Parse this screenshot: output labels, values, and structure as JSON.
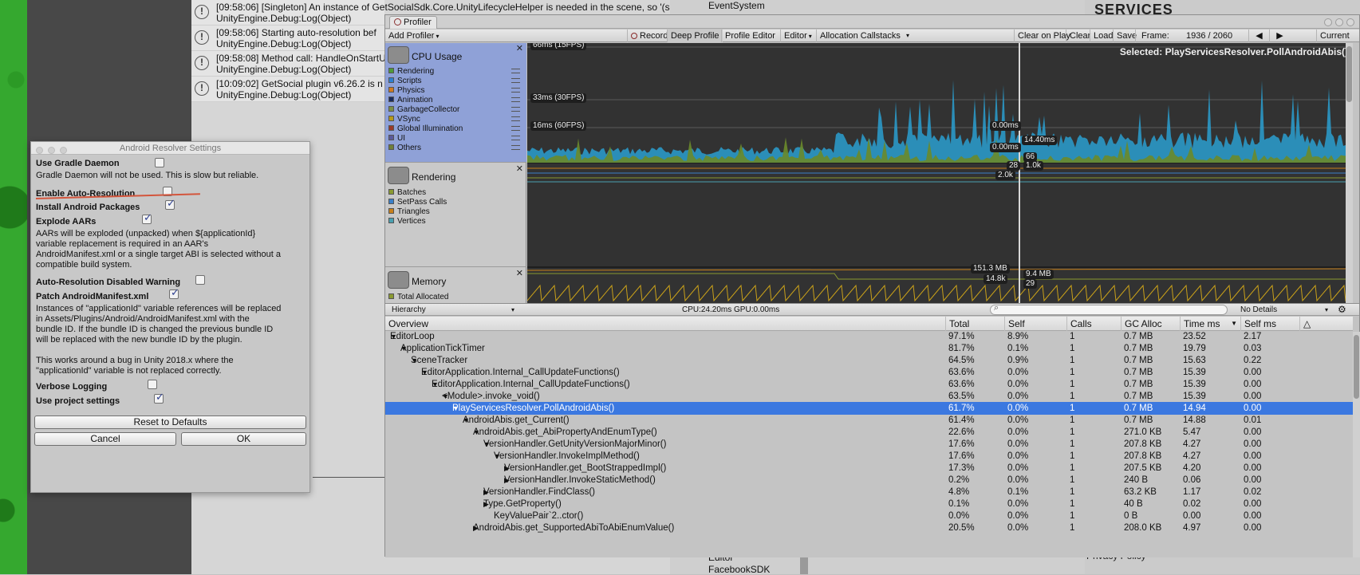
{
  "console": {
    "messages": [
      {
        "line1": "[09:58:06] [Singleton] An instance of GetSocialSdk.Core.UnityLifecycleHelper is needed in the scene, so '(s",
        "line2": "UnityEngine.Debug:Log(Object)"
      },
      {
        "line1": "[09:58:06] Starting auto-resolution bef",
        "line2": "UnityEngine.Debug:Log(Object)"
      },
      {
        "line1": "[09:58:08] Method call: HandleOnStartU",
        "line2": "UnityEngine.Debug:Log(Object)"
      },
      {
        "line1": "[10:09:02] GetSocial plugin v6.26.2 is n",
        "line2": "UnityEngine.Debug:Log(Object)"
      }
    ]
  },
  "hierarchy_bg": {
    "event_system": "EventSystem",
    "editor": "Editor",
    "facebook_sdk": "FacebookSDK"
  },
  "services": {
    "title": "SERVICES",
    "privacy": "Privacy Policy"
  },
  "android_resolver": {
    "title": "Android Resolver Settings",
    "use_gradle_daemon": {
      "label": "Use Gradle Daemon",
      "checked": false,
      "desc": "Gradle Daemon will not be used.  This is slow but reliable."
    },
    "enable_auto_resolution": {
      "label": "Enable Auto-Resolution",
      "checked": false
    },
    "install_android_packages": {
      "label": "Install Android Packages",
      "checked": true
    },
    "explode_aars": {
      "label": "Explode AARs",
      "checked": true,
      "desc_lines": [
        "AARs will be exploded (unpacked) when ${applicationId}",
        "variable replacement is required in an AAR's",
        "AndroidManifest.xml or a single target ABI is selected without a",
        "compatible build system."
      ]
    },
    "auto_resolution_disabled_warning": {
      "label": "Auto-Resolution Disabled Warning",
      "checked": false
    },
    "patch_manifest": {
      "label": "Patch AndroidManifest.xml",
      "checked": true,
      "desc_lines": [
        "Instances of \"applicationId\" variable references will be replaced",
        "in Assets/Plugins/Android/AndroidManifest.xml with the",
        "bundle ID.  If the bundle ID is changed the previous bundle ID",
        "will be replaced with the new bundle ID by the plugin.",
        "",
        "This works around a bug in Unity 2018.x where the",
        "\"applicationId\" variable is not replaced correctly."
      ]
    },
    "verbose_logging": {
      "label": "Verbose Logging",
      "checked": false
    },
    "use_project_settings": {
      "label": "Use project settings",
      "checked": true
    },
    "reset_label": "Reset to Defaults",
    "cancel_label": "Cancel",
    "ok_label": "OK"
  },
  "profiler": {
    "tab_label": "Profiler",
    "toolbar": {
      "add_profiler": "Add Profiler",
      "record": "Record",
      "deep_profile": "Deep Profile",
      "profile_editor": "Profile Editor",
      "editor": "Editor",
      "allocation_callstacks": "Allocation Callstacks",
      "clear_on_play": "Clear on Play",
      "clear": "Clear",
      "load": "Load",
      "save": "Save",
      "frame_label": "Frame:",
      "frame_value": "1936 / 2060",
      "prev": "◀",
      "next": "▶",
      "current": "Current"
    },
    "modules": {
      "cpu": {
        "title": "CPU Usage",
        "legend": [
          {
            "name": "Rendering",
            "color": "#4f9a3a"
          },
          {
            "name": "Scripts",
            "color": "#2e7fd0"
          },
          {
            "name": "Physics",
            "color": "#d07a20"
          },
          {
            "name": "Animation",
            "color": "#1a2a5a"
          },
          {
            "name": "GarbageCollector",
            "color": "#7a8f46"
          },
          {
            "name": "VSync",
            "color": "#b59a1a"
          },
          {
            "name": "Global Illumination",
            "color": "#9a3a2a"
          },
          {
            "name": "UI",
            "color": "#5a5a9a"
          },
          {
            "name": "Others",
            "color": "#6f7f3a"
          }
        ]
      },
      "rendering": {
        "title": "Rendering",
        "legend": [
          {
            "name": "Batches",
            "color": "#8a9a30"
          },
          {
            "name": "SetPass Calls",
            "color": "#3a80c8"
          },
          {
            "name": "Triangles",
            "color": "#c8801a"
          },
          {
            "name": "Vertices",
            "color": "#4aa0b0"
          }
        ]
      },
      "memory": {
        "title": "Memory",
        "legend": [
          {
            "name": "Total Allocated",
            "color": "#8a9a30"
          }
        ]
      }
    },
    "chart": {
      "selected": "Selected: PlayServicesResolver.PollAndroidAbis()",
      "fps_66": "66ms (15FPS)",
      "fps_33": "33ms (30FPS)",
      "fps_16": "16ms (60FPS)",
      "cpu_val1": "0.00ms",
      "cpu_val2": "0.00ms",
      "cpu_val3": "14.40ms",
      "rend_66": "66",
      "rend_28": "28",
      "rend_1k": "1.0k",
      "rend_2k": "2.0k",
      "mem_151": "151.3 MB",
      "mem_14": "14.8k",
      "mem_94": "9.4 MB",
      "mem_29": "29",
      "colors": {
        "bg": "#323232",
        "scripts": "#2a9fd0",
        "rendering": "#6a8a2a",
        "gc": "#7f9a3a",
        "cursor": "#d8d8d8"
      }
    },
    "hierarchy_bar": {
      "view": "Hierarchy",
      "cpu_gpu": "CPU:24.20ms   GPU:0.00ms",
      "details": "No Details"
    },
    "table": {
      "headers": [
        "Overview",
        "Total",
        "Self",
        "Calls",
        "GC Alloc",
        "Time ms",
        "Self ms"
      ],
      "rows": [
        {
          "depth": 0,
          "exp": "▼",
          "name": "EditorLoop",
          "total": "97.1%",
          "self": "8.9%",
          "calls": "1",
          "gc": "0.7 MB",
          "time": "23.52",
          "selfms": "2.17"
        },
        {
          "depth": 1,
          "exp": "▼",
          "name": "ApplicationTickTimer",
          "total": "81.7%",
          "self": "0.1%",
          "calls": "1",
          "gc": "0.7 MB",
          "time": "19.79",
          "selfms": "0.03"
        },
        {
          "depth": 2,
          "exp": "▼",
          "name": "SceneTracker",
          "total": "64.5%",
          "self": "0.9%",
          "calls": "1",
          "gc": "0.7 MB",
          "time": "15.63",
          "selfms": "0.22"
        },
        {
          "depth": 3,
          "exp": "▼",
          "name": "EditorApplication.Internal_CallUpdateFunctions()",
          "total": "63.6%",
          "self": "0.0%",
          "calls": "1",
          "gc": "0.7 MB",
          "time": "15.39",
          "selfms": "0.00"
        },
        {
          "depth": 4,
          "exp": "▼",
          "name": "EditorApplication.Internal_CallUpdateFunctions()",
          "total": "63.6%",
          "self": "0.0%",
          "calls": "1",
          "gc": "0.7 MB",
          "time": "15.39",
          "selfms": "0.00"
        },
        {
          "depth": 5,
          "exp": "▼",
          "name": "<Module>.invoke_void()",
          "total": "63.5%",
          "self": "0.0%",
          "calls": "1",
          "gc": "0.7 MB",
          "time": "15.39",
          "selfms": "0.00"
        },
        {
          "depth": 6,
          "exp": "▼",
          "name": "PlayServicesResolver.PollAndroidAbis()",
          "total": "61.7%",
          "self": "0.0%",
          "calls": "1",
          "gc": "0.7 MB",
          "time": "14.94",
          "selfms": "0.00",
          "selected": true
        },
        {
          "depth": 7,
          "exp": "▼",
          "name": "AndroidAbis.get_Current()",
          "total": "61.4%",
          "self": "0.0%",
          "calls": "1",
          "gc": "0.7 MB",
          "time": "14.88",
          "selfms": "0.01"
        },
        {
          "depth": 8,
          "exp": "▼",
          "name": "AndroidAbis.get_AbiPropertyAndEnumType()",
          "total": "22.6%",
          "self": "0.0%",
          "calls": "1",
          "gc": "271.0 KB",
          "time": "5.47",
          "selfms": "0.00"
        },
        {
          "depth": 9,
          "exp": "▼",
          "name": "VersionHandler.GetUnityVersionMajorMinor()",
          "total": "17.6%",
          "self": "0.0%",
          "calls": "1",
          "gc": "207.8 KB",
          "time": "4.27",
          "selfms": "0.00"
        },
        {
          "depth": 10,
          "exp": "▼",
          "name": "VersionHandler.InvokeImplMethod()",
          "total": "17.6%",
          "self": "0.0%",
          "calls": "1",
          "gc": "207.8 KB",
          "time": "4.27",
          "selfms": "0.00"
        },
        {
          "depth": 11,
          "exp": "▶",
          "name": "VersionHandler.get_BootStrappedImpl()",
          "total": "17.3%",
          "self": "0.0%",
          "calls": "1",
          "gc": "207.5 KB",
          "time": "4.20",
          "selfms": "0.00"
        },
        {
          "depth": 11,
          "exp": "▶",
          "name": "VersionHandler.InvokeStaticMethod()",
          "total": "0.2%",
          "self": "0.0%",
          "calls": "1",
          "gc": "240 B",
          "time": "0.06",
          "selfms": "0.00"
        },
        {
          "depth": 9,
          "exp": "▶",
          "name": "VersionHandler.FindClass()",
          "total": "4.8%",
          "self": "0.1%",
          "calls": "1",
          "gc": "63.2 KB",
          "time": "1.17",
          "selfms": "0.02"
        },
        {
          "depth": 9,
          "exp": "▶",
          "name": "Type.GetProperty()",
          "total": "0.1%",
          "self": "0.0%",
          "calls": "1",
          "gc": "40 B",
          "time": "0.02",
          "selfms": "0.00"
        },
        {
          "depth": 9,
          "exp": "",
          "name": "KeyValuePair`2..ctor()",
          "total": "0.0%",
          "self": "0.0%",
          "calls": "1",
          "gc": "0 B",
          "time": "0.00",
          "selfms": "0.00"
        },
        {
          "depth": 8,
          "exp": "▶",
          "name": "AndroidAbis.get_SupportedAbiToAbiEnumValue()",
          "total": "20.5%",
          "self": "0.0%",
          "calls": "1",
          "gc": "208.0 KB",
          "time": "4.97",
          "selfms": "0.00"
        }
      ]
    }
  }
}
